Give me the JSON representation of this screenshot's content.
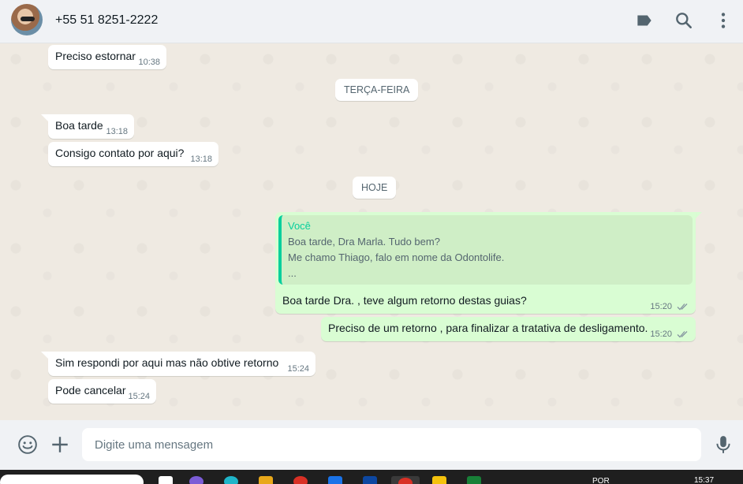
{
  "header": {
    "contact_name": "+55 51 8251-2222",
    "icons": [
      "label-icon",
      "search-icon",
      "menu-icon"
    ]
  },
  "messages": [
    {
      "direction": "in",
      "text": "Preciso estornar",
      "time": "10:38"
    },
    {
      "type": "date",
      "text": "TERÇA-FEIRA"
    },
    {
      "direction": "in",
      "text": "Boa tarde",
      "time": "13:18"
    },
    {
      "direction": "in",
      "text": "Consigo contato por aqui?",
      "time": "13:18"
    },
    {
      "type": "date",
      "text": "HOJE"
    },
    {
      "direction": "out",
      "quote": {
        "author": "Você",
        "lines": [
          "Boa tarde, Dra Marla. Tudo bem?",
          "Me chamo Thiago, falo em nome da Odontolife.",
          "..."
        ]
      },
      "text": "Boa tarde Dra. , teve algum retorno destas guias?",
      "time": "15:20"
    },
    {
      "direction": "out",
      "text": "Preciso de um retorno , para finalizar a tratativa de desligamento.",
      "time": "15:20"
    },
    {
      "direction": "in",
      "text": "Sim respondi por aqui mas não obtive retorno",
      "time": "15:24"
    },
    {
      "direction": "in",
      "text": "Pode cancelar",
      "time": "15:24"
    }
  ],
  "composer": {
    "placeholder": "Digite uma mensagem",
    "icons": [
      "emoji-icon",
      "attach-plus-icon",
      "microphone-icon"
    ]
  },
  "taskbar": {
    "language": "POR",
    "clock": "15:37"
  },
  "colors": {
    "accent": "#06cf9c",
    "outgoing_bubble": "#d9fdd3",
    "chat_background": "#efeae2",
    "header_background": "#f0f2f5"
  }
}
